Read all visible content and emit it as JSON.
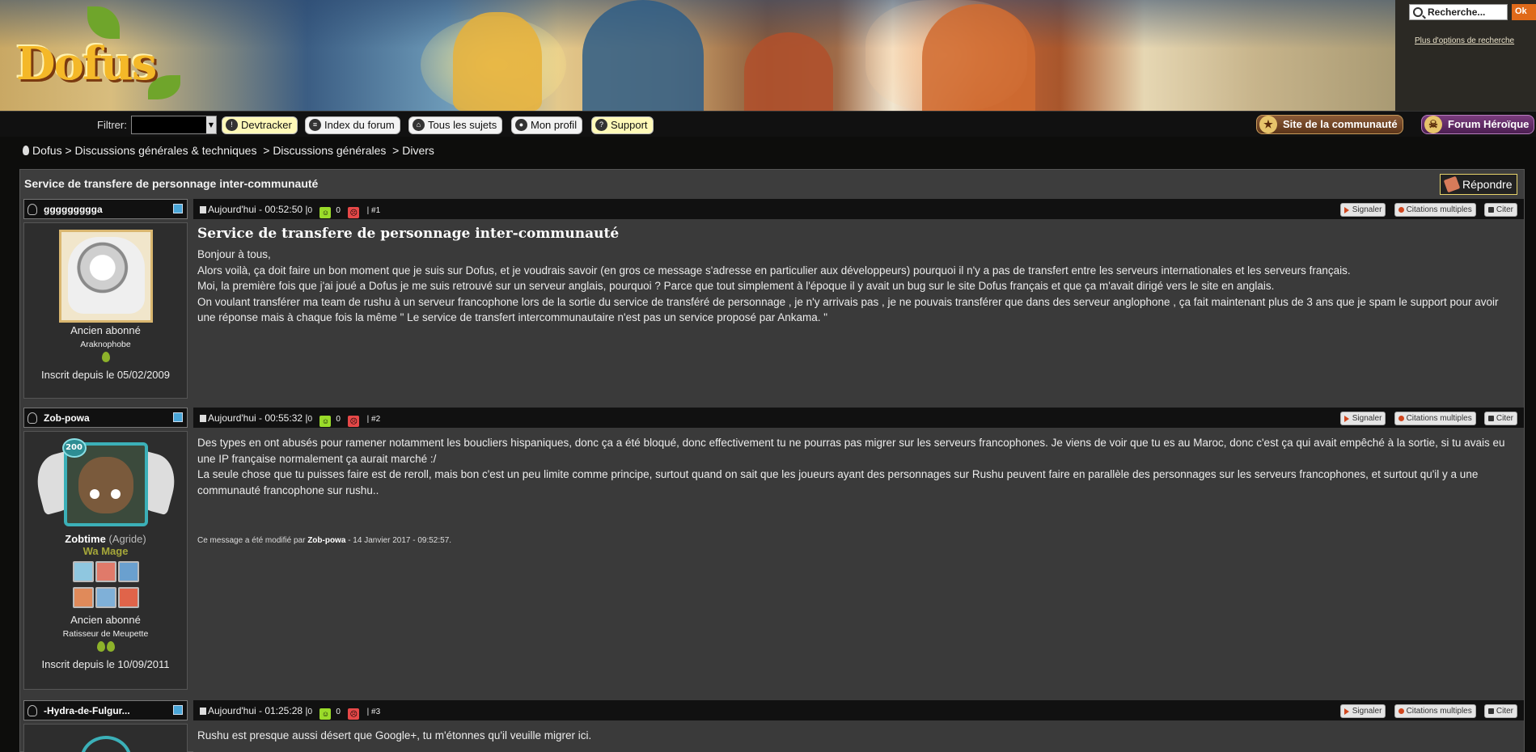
{
  "search": {
    "placeholder": "Recherche...",
    "go_label": "Ok",
    "more_options": "Plus d'options de recherche"
  },
  "logo": {
    "text": "Dofus"
  },
  "toolbar": {
    "filter_label": "Filtrer:",
    "buttons": [
      {
        "label": "Devtracker",
        "icon": "devtracker-icon"
      },
      {
        "label": "Index du forum",
        "icon": "list-icon"
      },
      {
        "label": "Tous les sujets",
        "icon": "home-icon"
      },
      {
        "label": "Mon profil",
        "icon": "profile-icon"
      },
      {
        "label": "Support",
        "icon": "support-icon"
      }
    ],
    "community_site": "Site de la communauté",
    "heroic_forum": "Forum Héroïque"
  },
  "breadcrumb": {
    "items": [
      "Dofus",
      "Discussions générales & techniques",
      "Discussions générales",
      "Divers"
    ],
    "separator": ">"
  },
  "thread": {
    "title": "Service de transfere de personnage inter-communauté",
    "reply_label": "Répondre"
  },
  "post_actions": {
    "report": "Signaler",
    "multi_quote": "Citations multiples",
    "quote": "Citer"
  },
  "posts": [
    {
      "author": "ggggggggga",
      "time": "Aujourd'hui - 00:52:50",
      "sep": "|",
      "up_count_left": "0",
      "down_count": "0",
      "number": "| #1",
      "title": "Service de transfere de personnage inter-communauté",
      "lines": [
        "Bonjour à tous,",
        "Alors voilà, ça doit faire un bon moment que je suis sur Dofus, et je voudrais savoir (en gros ce message s'adresse en particulier aux développeurs) pourquoi il n'y a pas de transfert entre les serveurs internationales et les serveurs français.",
        "Moi, la première fois que j'ai joué a Dofus je me suis retrouvé sur un serveur anglais, pourquoi ? Parce que tout simplement à l'époque il y avait un bug sur le site Dofus français et que ça m'avait dirigé vers le site en anglais.",
        "On voulant transférer ma team de rushu à un serveur francophone lors de la sortie du service de transféré de personnage , je n'y arrivais pas , je ne pouvais transférer que dans des serveur anglophone , ça fait maintenant plus de 3 ans que je spam le support pour avoir une réponse mais à chaque fois la même \" Le service de transfert intercommunautaire n'est pas un service proposé par Ankama. \""
      ],
      "rank": "Ancien abonné",
      "subrank": "Araknophobe",
      "joined": "Inscrit depuis le 05/02/2009"
    },
    {
      "author": "Zob-powa",
      "time": "Aujourd'hui - 00:55:32",
      "sep": "|",
      "up_count_left": "0",
      "down_count": "0",
      "number": "| #2",
      "lines": [
        "Des types en ont abusés pour ramener notamment les boucliers hispaniques, donc ça a été bloqué, donc effectivement tu ne pourras pas migrer sur les serveurs francophones. Je viens de voir que tu es au Maroc, donc c'est ça qui avait empêché à la sortie, si tu avais eu une IP française normalement ça aurait marché :/",
        "La seule chose que tu puisses faire est de reroll, mais bon c'est un peu limite comme principe, surtout quand on sait que les joueurs ayant des personnages sur Rushu peuvent faire en parallèle des personnages sur les serveurs francophones, et surtout qu'il y a une communauté francophone sur rushu.."
      ],
      "edit_prefix": "Ce message a été modifié par",
      "edit_user": "Zob-powa",
      "edit_date": "- 14 Janvier 2017 - 09:52:57.",
      "level": "200",
      "char_name": "Zobtime",
      "char_guild": "(Agride)",
      "char_class": "Wa Mage",
      "rank": "Ancien abonné",
      "subrank": "Ratisseur de Meupette",
      "joined": "Inscrit depuis le 10/09/2011"
    },
    {
      "author": "-Hydra-de-Fulgur...",
      "time": "Aujourd'hui - 01:25:28",
      "sep": "|",
      "up_count_left": "0",
      "down_count": "0",
      "number": "| #3",
      "lines": [
        "Rushu est presque aussi désert que Google+, tu m'étonnes qu'il veuille migrer ici."
      ]
    }
  ],
  "colors": {
    "background": "#0d0d0c",
    "panel": "#3a3a3a",
    "accent_yellow": "#e6d36a",
    "class_color": "#a6a83a"
  }
}
